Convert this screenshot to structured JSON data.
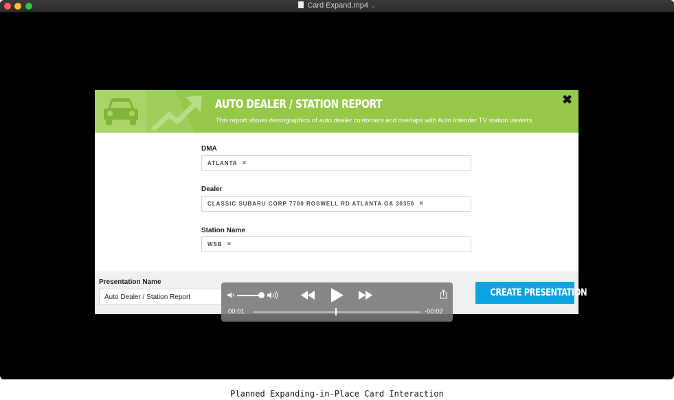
{
  "window": {
    "title": "Card Expand.mp4"
  },
  "card": {
    "title": "AUTO DEALER / STATION REPORT",
    "subtitle": "This report shows demographics of auto dealer customers and overlaps with Auto Intender TV station viewers.",
    "close_icon": "✖",
    "accent_color": "#96c94a",
    "fields": [
      {
        "label": "DMA",
        "tag": "ATLANTA"
      },
      {
        "label": "Dealer",
        "tag": "CLASSIC SUBARU CORP 7700 ROSWELL RD ATLANTA GA 30350"
      },
      {
        "label": "Station Name",
        "tag": "WSB"
      }
    ],
    "tag_remove_icon": "×",
    "presentation_label": "Presentation Name",
    "presentation_value": "Auto Dealer / Station Report",
    "create_button": "CREATE PRESENTATION",
    "button_color": "#0aa4e2"
  },
  "player": {
    "elapsed": "00:01",
    "remaining": "-00:02",
    "progress_fraction": 0.5,
    "volume_fraction": 0.9
  },
  "caption": "Planned Expanding-in-Place Card Interaction"
}
